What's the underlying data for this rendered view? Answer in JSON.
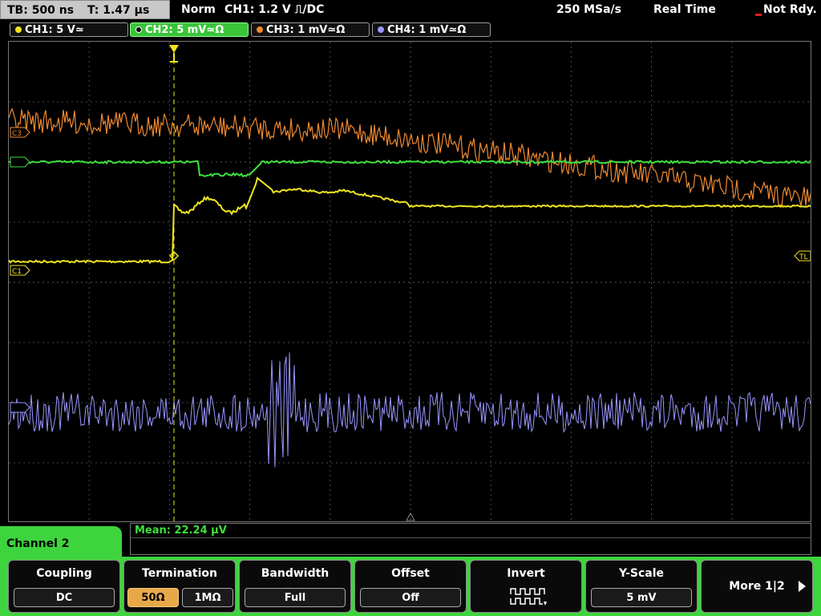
{
  "topbar": {
    "timebase": "TB: 500 ns",
    "trigger_time": "T: 1.47 µs",
    "trigger_mode": "Norm",
    "trigger_source": "CH1: 1.2 V ⎍/DC",
    "sample_rate": "250 MSa/s",
    "acquisition_mode": "Real Time",
    "status": "Not Rdy."
  },
  "channels": [
    {
      "label": "CH1: 5 V≃",
      "color": "#f0e620",
      "active": false
    },
    {
      "label": "CH2: 5 mV≃Ω",
      "color": "#3ee03e",
      "active": true
    },
    {
      "label": "CH3: 1 mV≃Ω",
      "color": "#f08a30",
      "active": false
    },
    {
      "label": "CH4: 1 mV≃Ω",
      "color": "#9a96ff",
      "active": false
    }
  ],
  "markers": {
    "c1": "C1",
    "c3": "C3",
    "trigger_level": "TL"
  },
  "measurement": {
    "text": "Mean: 22.24 µV"
  },
  "menu": {
    "title": "Channel 2",
    "coupling": {
      "title": "Coupling",
      "value": "DC"
    },
    "termination": {
      "title": "Termination",
      "options": [
        "50Ω",
        "1MΩ"
      ],
      "selected": 0
    },
    "bandwidth": {
      "title": "Bandwidth",
      "value": "Full"
    },
    "offset": {
      "title": "Offset",
      "value": "Off"
    },
    "invert": {
      "title": "Invert"
    },
    "yscale": {
      "title": "Y-Scale",
      "value": "5 mV"
    },
    "more": {
      "label": "More 1|2"
    }
  },
  "colors": {
    "ch1": "#f0e620",
    "ch2": "#3ee03e",
    "ch3": "#f08a30",
    "ch4": "#9a96ff",
    "grid": "#4a4a4a",
    "menu_accent": "#3ed43e"
  }
}
